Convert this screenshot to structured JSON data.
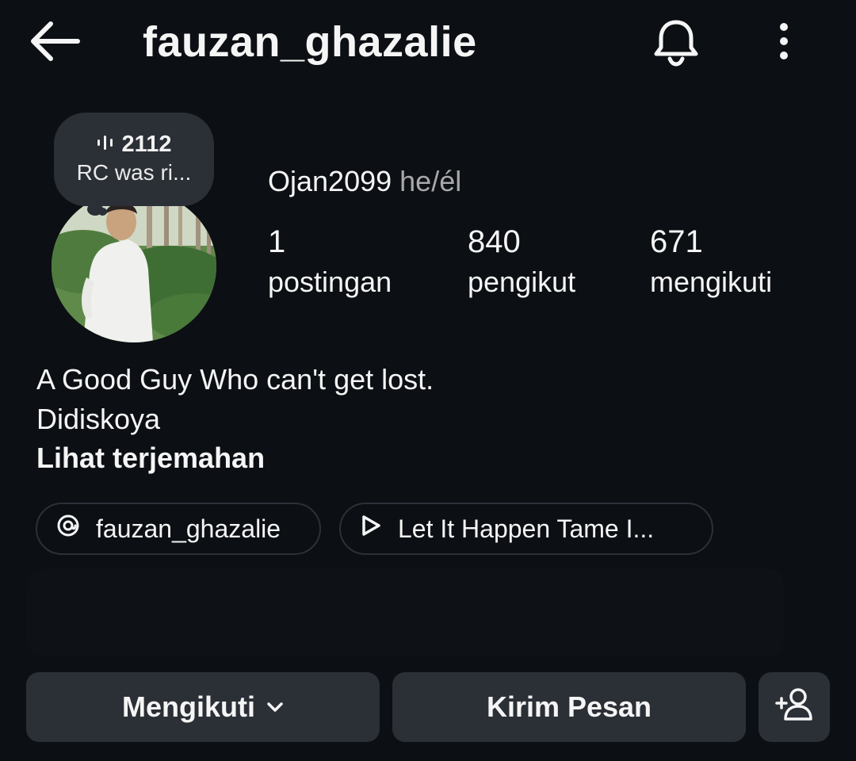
{
  "header": {
    "username": "fauzan_ghazalie",
    "back_icon": "arrow-left-icon",
    "bell_icon": "bell-icon",
    "more_icon": "more-vertical-icon"
  },
  "note": {
    "count": "2112",
    "text": "RC was ri..."
  },
  "profile": {
    "display_name": "Ojan2099",
    "pronouns": "he/él"
  },
  "stats": [
    {
      "value": "1",
      "label": "postingan"
    },
    {
      "value": "840",
      "label": "pengikut"
    },
    {
      "value": "671",
      "label": "mengikuti"
    }
  ],
  "bio": {
    "line1": "A Good Guy Who can't get lost.",
    "line2": "Didiskoya",
    "translate": "Lihat terjemahan"
  },
  "links": [
    {
      "icon": "threads-icon",
      "label": "fauzan_ghazalie"
    },
    {
      "icon": "play-icon",
      "label": "Let It Happen Tame I..."
    }
  ],
  "actions": {
    "following_label": "Mengikuti",
    "message_label": "Kirim Pesan",
    "add_user_icon": "add-user-icon"
  },
  "colors": {
    "background": "#0c0f14",
    "button": "#2b2f36",
    "muted_text": "#a8a8a8"
  }
}
